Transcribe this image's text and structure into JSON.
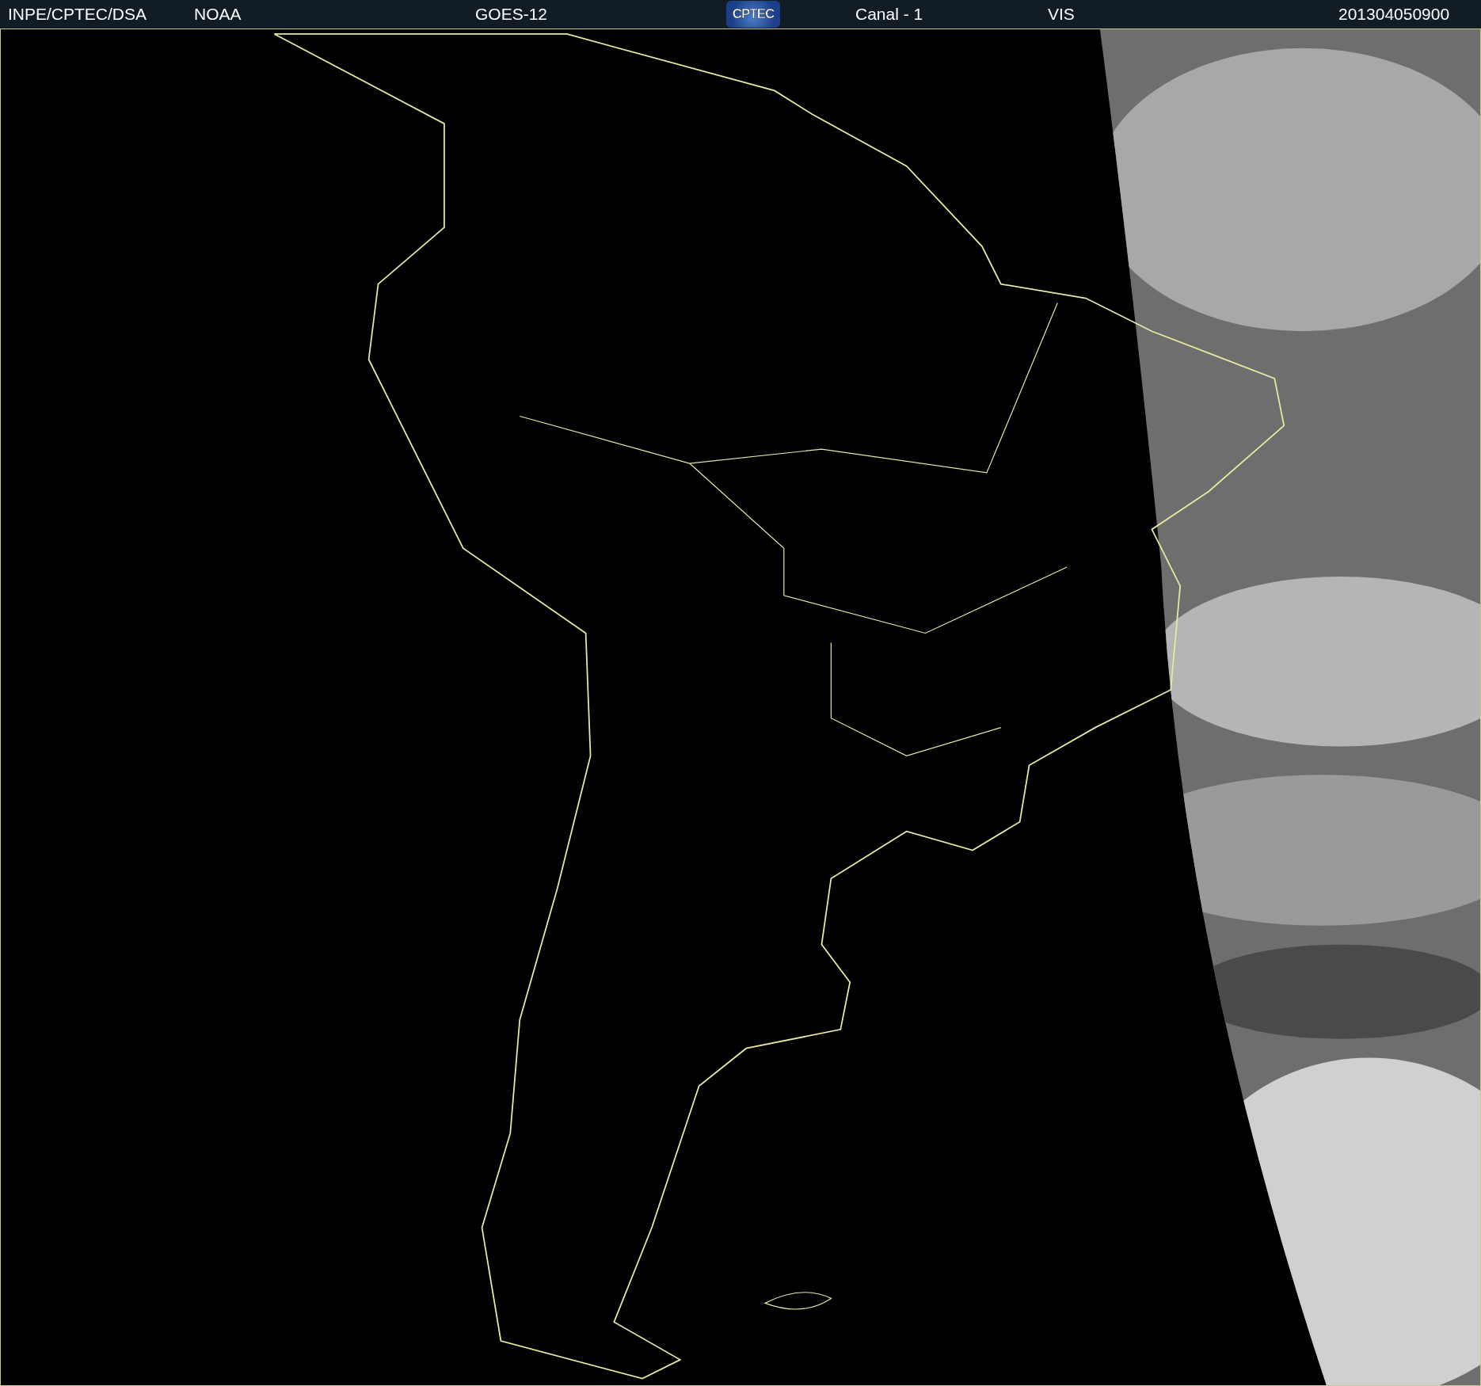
{
  "header": {
    "items": [
      {
        "kind": "text",
        "label": "INPE/CPTEC/DSA"
      },
      {
        "kind": "text",
        "label": "NOAA"
      },
      {
        "kind": "text",
        "label": "GOES-12"
      },
      {
        "kind": "logo",
        "label": "CPTEC"
      },
      {
        "kind": "text",
        "label": "Canal - 1"
      },
      {
        "kind": "text",
        "label": "VIS"
      },
      {
        "kind": "text",
        "label": "201304050900"
      }
    ]
  }
}
